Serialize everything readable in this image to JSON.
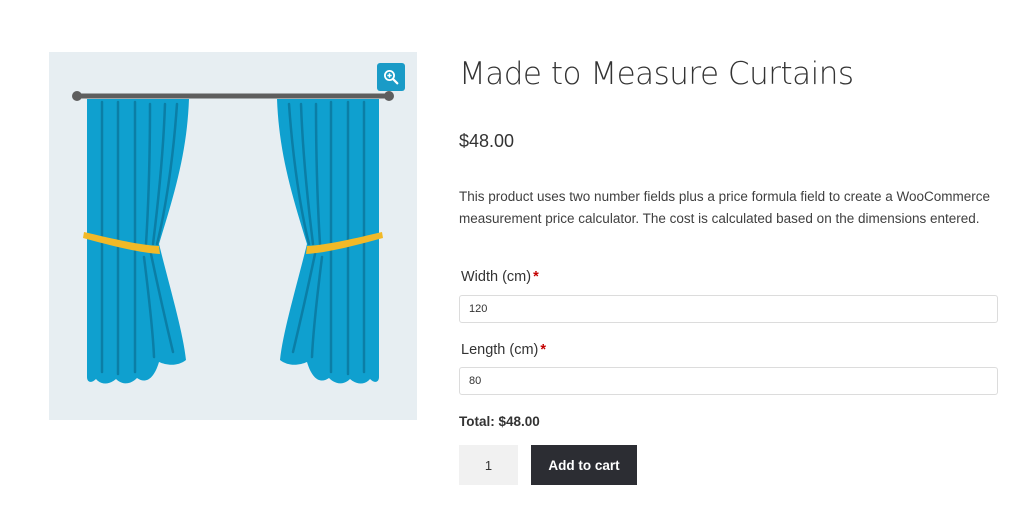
{
  "product": {
    "title": "Made to Measure Curtains",
    "price": "$48.00",
    "description": "This product uses two number fields plus a price formula field to create a WooCommerce measurement price calculator. The cost is calculated based on the dimensions entered."
  },
  "gallery": {
    "zoom_icon": "zoom-in-magnifier-icon",
    "image_subject": "curtain-illustration",
    "colors": {
      "background": "#e7eef2",
      "curtain": "#0fa0cf",
      "curtain_fold": "#0b7ea6",
      "rod": "#5e5e5e",
      "tieback": "#f2b927",
      "zoom_button": "#1a9bc7"
    }
  },
  "fields": {
    "width": {
      "label": "Width (cm)",
      "required_mark": "*",
      "value": "120"
    },
    "length": {
      "label": "Length (cm)",
      "required_mark": "*",
      "value": "80"
    }
  },
  "total": {
    "text": "Total: $48.00"
  },
  "cart": {
    "quantity": "1",
    "add_label": "Add to cart",
    "button_color": "#2c2d33"
  }
}
